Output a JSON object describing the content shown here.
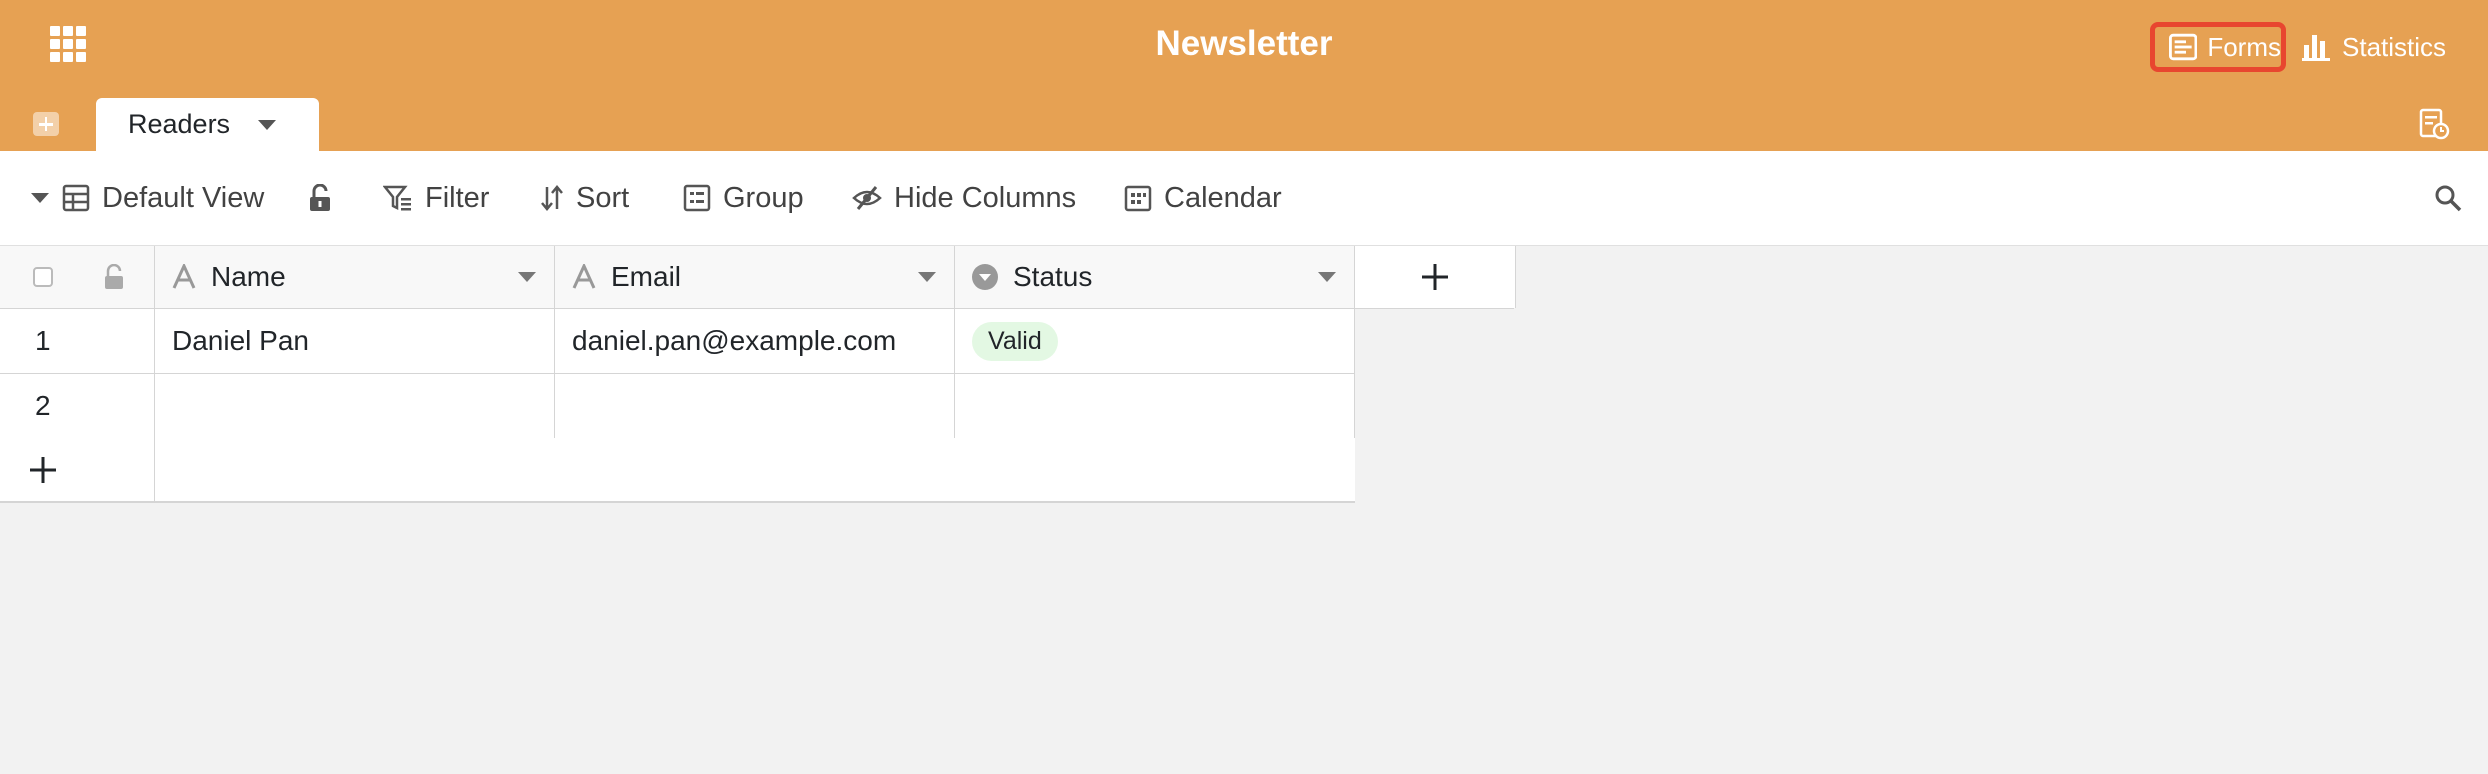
{
  "header": {
    "app_title": "Newsletter",
    "forms_label": "Forms",
    "statistics_label": "Statistics",
    "bg_color": "#e6a153",
    "highlight_color": "#e8462f"
  },
  "tabs": [
    {
      "label": "Readers",
      "active": true
    }
  ],
  "toolbar": {
    "view_label": "Default View",
    "filter_label": "Filter",
    "sort_label": "Sort",
    "group_label": "Group",
    "hide_columns_label": "Hide Columns",
    "calendar_label": "Calendar"
  },
  "table": {
    "columns": [
      {
        "name": "Name",
        "type": "text"
      },
      {
        "name": "Email",
        "type": "text"
      },
      {
        "name": "Status",
        "type": "single-select"
      }
    ],
    "rows": [
      {
        "index": "1",
        "name": "Daniel Pan",
        "email": "daniel.pan@example.com",
        "status": "Valid"
      },
      {
        "index": "2",
        "name": "",
        "email": "",
        "status": ""
      }
    ],
    "status_badge_color": "#e3f8e3"
  }
}
